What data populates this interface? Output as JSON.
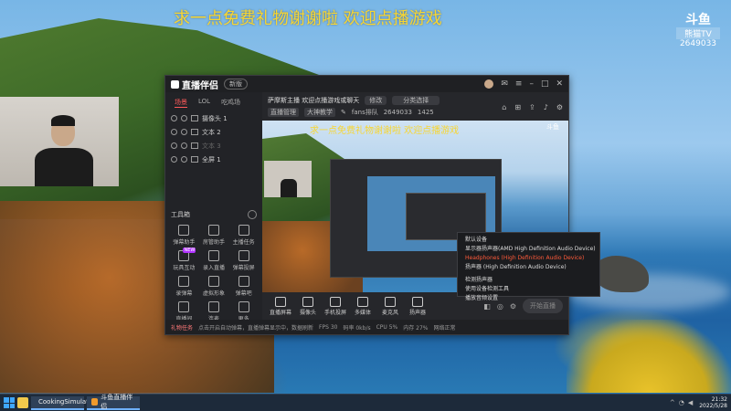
{
  "overlay": {
    "banner": "求一点免费礼物谢谢啦 欢迎点播游戏",
    "platform_logo_top": "斗鱼",
    "platform_logo_sub": "熊猫TV",
    "room_number": "2649033"
  },
  "app": {
    "name": "直播伴侣",
    "version_pill": "新版",
    "left_tabs": [
      "场景",
      "LOL",
      "吃鸡场"
    ],
    "layers": [
      {
        "label": "摄像头 1",
        "dim": false
      },
      {
        "label": "文本 2",
        "dim": false
      },
      {
        "label": "文本 3",
        "dim": true
      },
      {
        "label": "全屏 1",
        "dim": false
      }
    ],
    "toolbox_title": "工具箱",
    "tools": [
      {
        "label": "弹幕助手"
      },
      {
        "label": "房管助手"
      },
      {
        "label": "主播任务"
      },
      {
        "label": "玩具互动",
        "badge": "NEW"
      },
      {
        "label": "录入直播"
      },
      {
        "label": "弹幕投屏"
      },
      {
        "label": "录弹幕"
      },
      {
        "label": "虚拟形象"
      },
      {
        "label": "弹幕吧"
      },
      {
        "label": "直播间"
      },
      {
        "label": "连麦"
      },
      {
        "label": "更多"
      }
    ],
    "header": {
      "stream_title": "萨摩斯主播 欢迎点播游戏或聊天",
      "edit_label": "修改",
      "category_label": "分类选择",
      "row2": [
        "直播管理",
        "大神教学"
      ],
      "tag_label": "fans排队",
      "viewers": "2649033",
      "followers": "1425"
    },
    "preview_banner": "求一点免费礼物谢谢啦 欢迎点播游戏",
    "bottom_tools": [
      "直播屏幕",
      "摄像头",
      "手机投屏",
      "多媒体",
      "麦克风",
      "扬声器"
    ],
    "start_live": "开始直播",
    "status": {
      "warning": "礼物任务",
      "message": "点击开启自动弹幕，直播弹幕显示中，数据刷新",
      "fps": "FPS 30",
      "bitrate": "码率 0kb/s",
      "cpu": "CPU 5%",
      "mem": "内存 27%",
      "net": "网络正常"
    },
    "device_menu": [
      {
        "label": "默认设备",
        "selected": false
      },
      {
        "label": "显示器扬声器(AMD High Definition Audio Device)",
        "selected": false
      },
      {
        "label": "Headphones (High Definition Audio Device)",
        "selected": true
      },
      {
        "label": "扬声器 (High Definition Audio Device)",
        "selected": false
      },
      {
        "label": "",
        "separator": true
      },
      {
        "label": "检测扬声器",
        "selected": false
      },
      {
        "label": "使用设备检测工具",
        "selected": false
      },
      {
        "label": "播放音频设置",
        "selected": false
      }
    ]
  },
  "taskbar": {
    "tasks": [
      {
        "label": "CookingSimulator"
      },
      {
        "label": "斗鱼直播伴侣"
      }
    ],
    "time": "21:32",
    "date": "2022/5/28"
  }
}
